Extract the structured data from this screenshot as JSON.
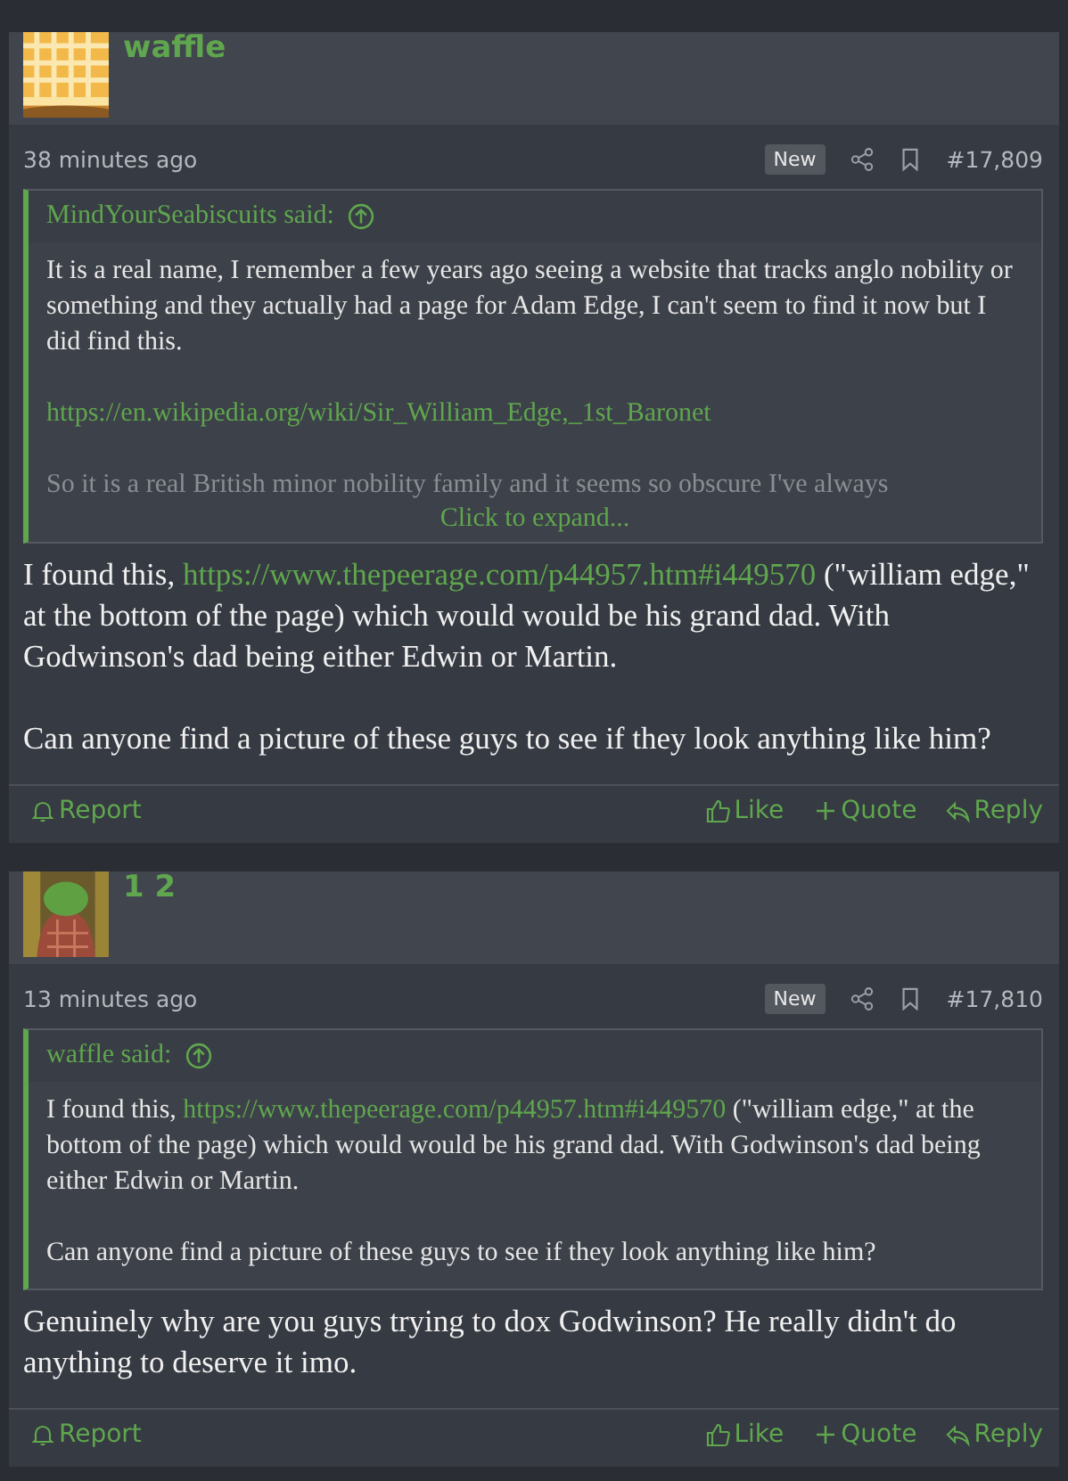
{
  "posts": [
    {
      "author": "waffle",
      "time": "38 minutes ago",
      "badge": "New",
      "number": "#17,809",
      "quote": {
        "author": "MindYourSeabiscuits said:",
        "collapsed": true,
        "expand": "Click to expand...",
        "paragraphs": [
          [
            {
              "kind": "text",
              "text": "It is a real name, I remember a few years ago seeing a website that tracks anglo nobility or something and they actually had a page for Adam Edge, I can't seem to find it now but I did find this."
            }
          ],
          [
            {
              "kind": "link",
              "text": "https://en.wikipedia.org/wiki/Sir_William_Edge,_1st_Baronet"
            }
          ],
          [
            {
              "kind": "text",
              "text": "So it is a real British minor nobility family and it seems so obscure I've always"
            }
          ]
        ]
      },
      "body": [
        [
          {
            "kind": "text",
            "text": "I found this, "
          },
          {
            "kind": "link",
            "text": "https://www.thepeerage.com/p44957.htm#i449570"
          },
          {
            "kind": "text",
            "text": " (\"william edge,\" at the bottom of the page) which would would be his grand dad. With Godwinson's dad being either Edwin or Martin."
          }
        ],
        [
          {
            "kind": "text",
            "text": "Can anyone find a picture of these guys to see if they look anything like him?"
          }
        ]
      ],
      "actions": {
        "report": "Report",
        "like": "Like",
        "quote": "Quote",
        "reply": "Reply"
      }
    },
    {
      "author": "1 2",
      "time": "13 minutes ago",
      "badge": "New",
      "number": "#17,810",
      "quote": {
        "author": "waffle said:",
        "collapsed": false,
        "paragraphs": [
          [
            {
              "kind": "text",
              "text": "I found this, "
            },
            {
              "kind": "link",
              "text": "https://www.thepeerage.com/p44957.htm#i449570"
            },
            {
              "kind": "text",
              "text": " (\"william edge,\" at the bottom of the page) which would would be his grand dad. With Godwinson's dad being either Edwin or Martin."
            }
          ],
          [
            {
              "kind": "text",
              "text": "Can anyone find a picture of these guys to see if they look anything like him?"
            }
          ]
        ]
      },
      "body": [
        [
          {
            "kind": "text",
            "text": "Genuinely why are you guys trying to dox Godwinson? He really didn't do anything to deserve it imo."
          }
        ]
      ],
      "actions": {
        "report": "Report",
        "like": "Like",
        "quote": "Quote",
        "reply": "Reply"
      }
    }
  ]
}
